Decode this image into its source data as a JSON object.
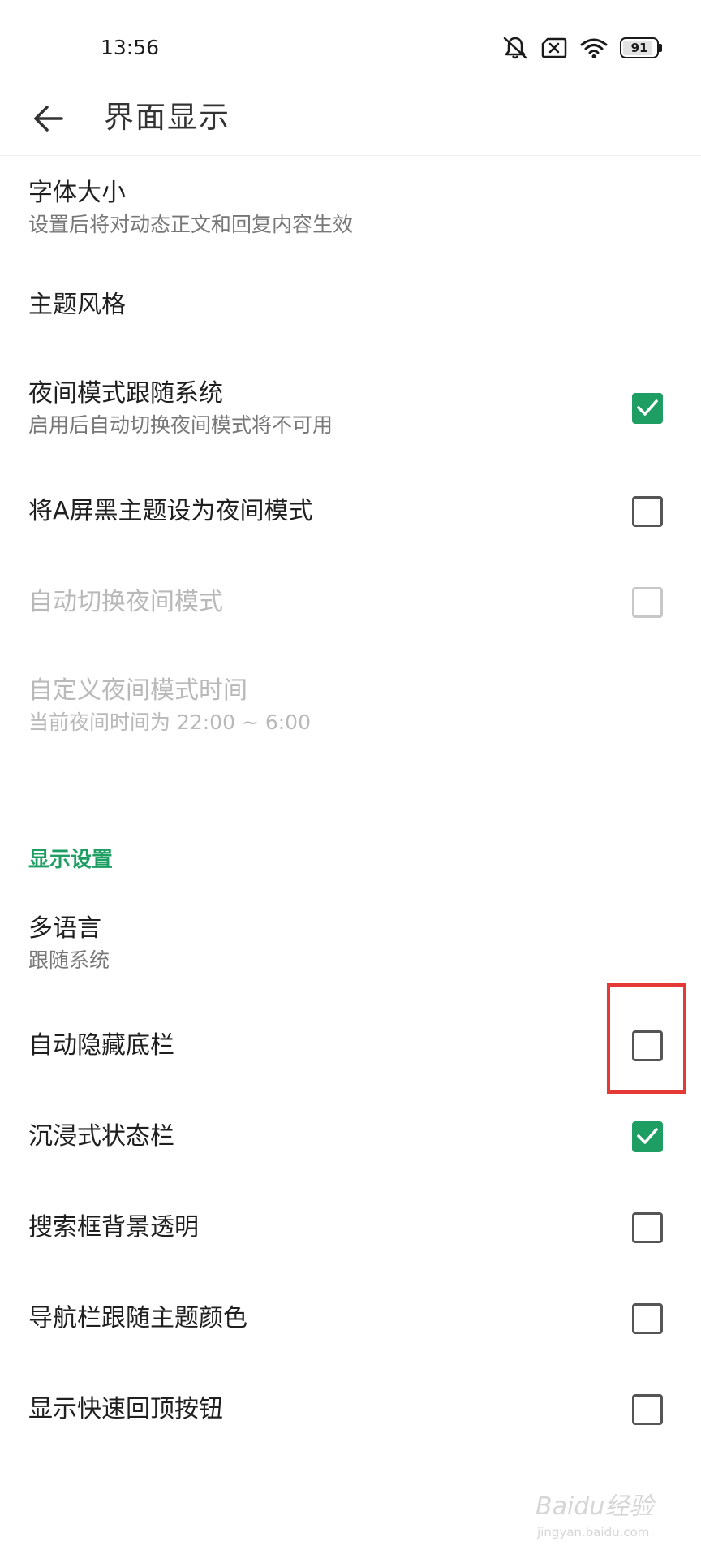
{
  "status_bar": {
    "time": "13:56",
    "battery_level": "91",
    "icons": [
      "mute-icon",
      "no-sim-icon",
      "wifi-icon",
      "battery-icon"
    ]
  },
  "header": {
    "title": "界面显示",
    "back_icon": "arrow-left-icon"
  },
  "settings": {
    "font_size": {
      "label": "字体大小",
      "sub": "设置后将对动态正文和回复内容生效"
    },
    "theme_style": {
      "label": "主题风格"
    },
    "night_follow_system": {
      "label": "夜间模式跟随系统",
      "sub": "启用后自动切换夜间模式将不可用",
      "checked": true
    },
    "a_black_theme_night": {
      "label": "将A屏黑主题设为夜间模式",
      "checked": false
    },
    "auto_switch_night": {
      "label": "自动切换夜间模式",
      "checked": false,
      "disabled": true
    },
    "custom_night_time": {
      "label": "自定义夜间模式时间",
      "sub": "当前夜间时间为 22:00 ~ 6:00",
      "disabled": true
    }
  },
  "display_section": {
    "header": "显示设置",
    "multi_language": {
      "label": "多语言",
      "sub": "跟随系统"
    },
    "auto_hide_bottom_bar": {
      "label": "自动隐藏底栏",
      "checked": false
    },
    "immersive_status_bar": {
      "label": "沉浸式状态栏",
      "checked": true
    },
    "search_box_transparent": {
      "label": "搜索框背景透明",
      "checked": false
    },
    "nav_bar_follow_theme": {
      "label": "导航栏跟随主题颜色",
      "checked": false
    },
    "show_back_to_top": {
      "label": "显示快速回顶按钮",
      "checked": false
    }
  },
  "colors": {
    "accent": "#1e9e63",
    "highlight": "#e53935",
    "text_primary": "#1f1f1f",
    "text_secondary": "#777777",
    "text_disabled": "#b9b9b9"
  },
  "watermark": {
    "text": "Baidu经验",
    "sub": "jingyan.baidu.com"
  }
}
